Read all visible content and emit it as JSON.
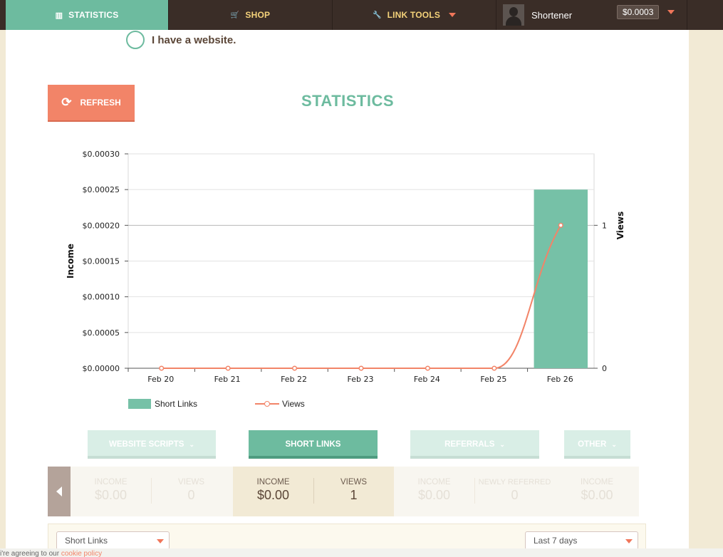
{
  "nav": {
    "items": [
      {
        "label": "STATISTICS",
        "icon": "bar-chart-icon",
        "glyph": "▥"
      },
      {
        "label": "SHOP",
        "icon": "cart-icon",
        "glyph": "🛒"
      },
      {
        "label": "LINK TOOLS",
        "icon": "wrench-icon",
        "glyph": "🔧"
      }
    ],
    "user": {
      "name": "Shortener",
      "balance": "$0.0003"
    }
  },
  "website_checkbox": {
    "label": "I have a website."
  },
  "refresh_button": {
    "label": "REFRESH"
  },
  "page_title": "STATISTICS",
  "chart_data": {
    "type": "bar",
    "categories": [
      "Feb 20",
      "Feb 21",
      "Feb 22",
      "Feb 23",
      "Feb 24",
      "Feb 25",
      "Feb 26"
    ],
    "series": [
      {
        "name": "Short Links",
        "type": "bar",
        "axis": "left",
        "values": [
          0,
          0,
          0,
          0,
          0,
          0,
          0.00025
        ]
      },
      {
        "name": "Views",
        "type": "line",
        "axis": "right",
        "values": [
          0,
          0,
          0,
          0,
          0,
          0,
          1
        ]
      }
    ],
    "ylabel": "Income",
    "y2label": "Views",
    "ylim": [
      0,
      0.0003
    ],
    "y2lim": [
      0,
      1.5
    ],
    "yticks": [
      "$0.00000",
      "$0.00005",
      "$0.00010",
      "$0.00015",
      "$0.00020",
      "$0.00025",
      "$0.00030"
    ],
    "y2ticks": [
      "0",
      "1"
    ],
    "legend": [
      "Short Links",
      "Views"
    ],
    "legend_position": "bottom-left",
    "grid": true,
    "colors": {
      "bars": "#76c1a7",
      "line": "#f28468"
    }
  },
  "tabs": [
    {
      "label": "WEBSITE SCRIPTS",
      "chevron": "⌄"
    },
    {
      "label": "SHORT LINKS",
      "chevron": ""
    },
    {
      "label": "REFERRALS",
      "chevron": "⌄"
    },
    {
      "label": "OTHER",
      "chevron": "⌄"
    }
  ],
  "stats": [
    {
      "a_label": "INCOME",
      "a_value": "$0.00",
      "b_label": "VIEWS",
      "b_value": "0"
    },
    {
      "a_label": "INCOME",
      "a_value": "$0.00",
      "b_label": "VIEWS",
      "b_value": "1"
    },
    {
      "a_label": "INCOME",
      "a_value": "$0.00",
      "b_label": "NEWLY REFERRED",
      "b_value": "0"
    },
    {
      "a_label": "INCOME",
      "a_value": "$0.00"
    }
  ],
  "filters": {
    "type_select": "Short Links",
    "range_select": "Last 7 days"
  },
  "cookie": {
    "text": "i're agreeing to our ",
    "link": "cookie policy"
  },
  "colors": {
    "accent": "#6dbb9f",
    "orange": "#f28468",
    "nav_bg": "#3a2d27",
    "nav_text": "#f4d27a"
  }
}
